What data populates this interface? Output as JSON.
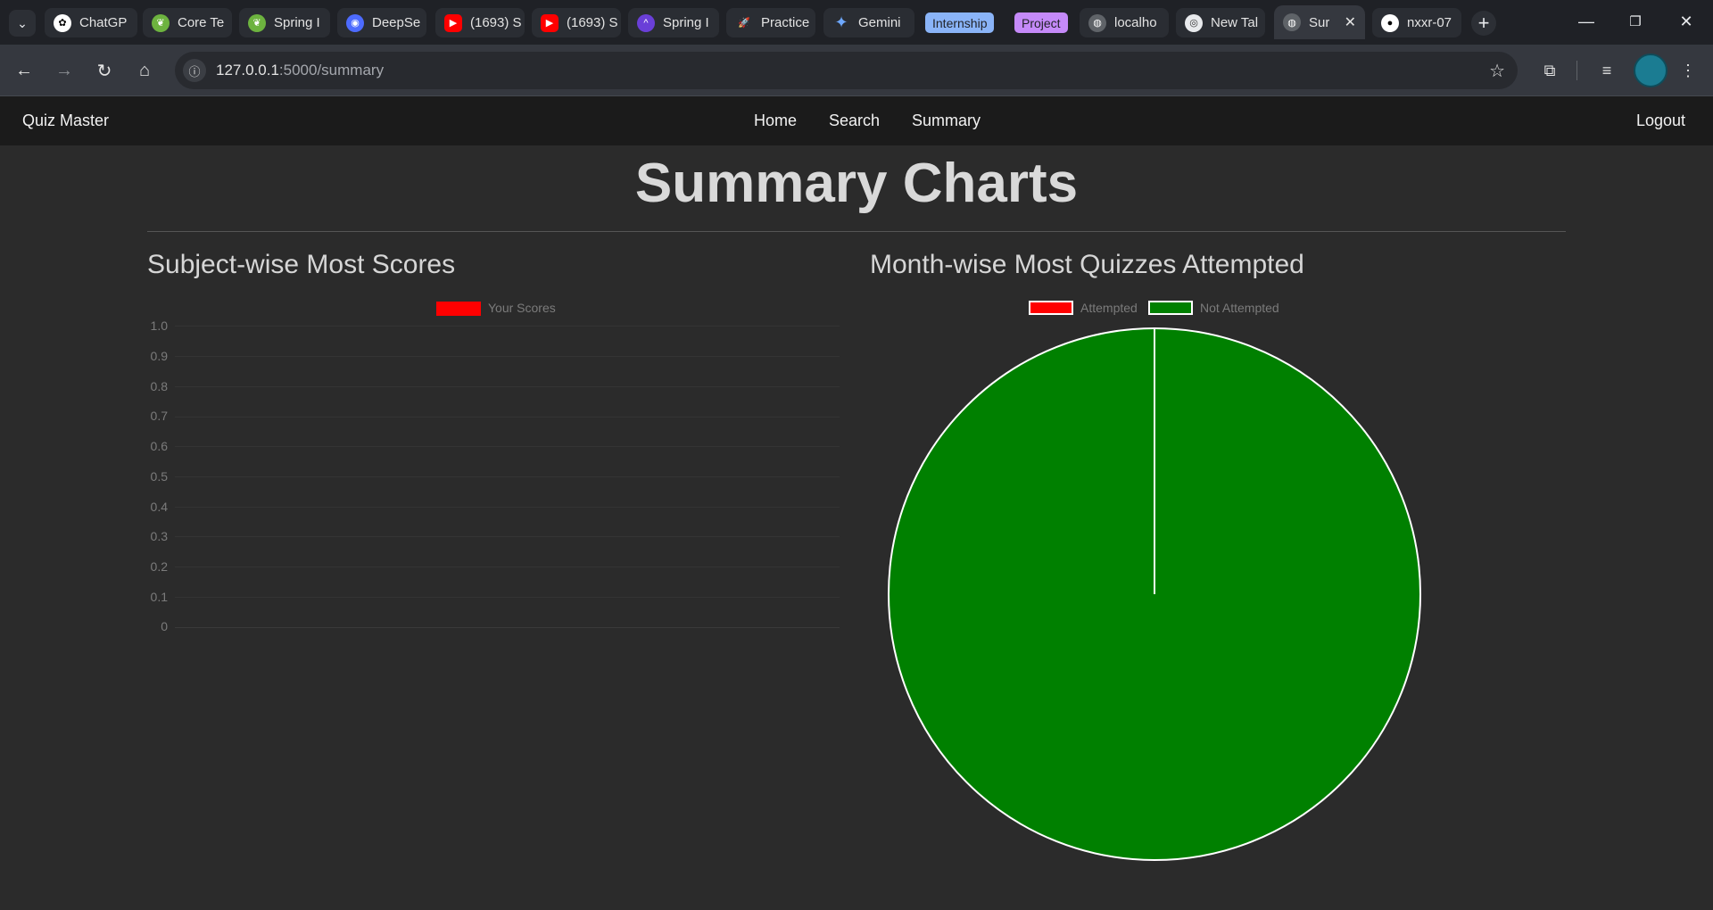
{
  "browser": {
    "tabs": [
      {
        "title": "ChatGP",
        "icon": "chatgpt-icon"
      },
      {
        "title": "Core Te",
        "icon": "spring-leaf-icon"
      },
      {
        "title": "Spring I",
        "icon": "spring-leaf-icon"
      },
      {
        "title": "DeepSe",
        "icon": "deepseek-whale-icon"
      },
      {
        "title": "(1693) S",
        "icon": "youtube-icon"
      },
      {
        "title": "(1693) S",
        "icon": "youtube-icon"
      },
      {
        "title": "Spring I",
        "icon": "spring-course-icon"
      },
      {
        "title": "Practice",
        "icon": "rocket-icon"
      },
      {
        "title": "Gemini",
        "icon": "gemini-sparkle-icon"
      },
      {
        "title": "localho",
        "icon": "globe-icon"
      },
      {
        "title": "New Tal",
        "icon": "chrome-icon"
      },
      {
        "title": "Sur",
        "icon": "globe-icon",
        "active": true
      },
      {
        "title": "nxxr-07",
        "icon": "github-icon"
      }
    ],
    "tab_groups": [
      {
        "label": "Internship",
        "color": "#8ab4f8"
      },
      {
        "label": "Project",
        "color": "#c58af9"
      }
    ],
    "url_host": "127.0.0.1",
    "url_path": ":5000/summary"
  },
  "app": {
    "brand": "Quiz Master",
    "nav": {
      "home": "Home",
      "search": "Search",
      "summary": "Summary",
      "logout": "Logout"
    },
    "page_title": "Summary Charts"
  },
  "chart_data": [
    {
      "type": "bar",
      "title": "Subject-wise Most Scores",
      "categories": [],
      "series": [
        {
          "name": "Your Scores",
          "values": [],
          "color": "#ff0000"
        }
      ],
      "yticks": [
        "1.0",
        "0.9",
        "0.8",
        "0.7",
        "0.6",
        "0.5",
        "0.4",
        "0.3",
        "0.2",
        "0.1",
        "0"
      ],
      "ylim": [
        0,
        1
      ],
      "legend": "top-center"
    },
    {
      "type": "pie",
      "title": "Month-wise Most Quizzes Attempted",
      "labels": [
        "Attempted",
        "Not Attempted"
      ],
      "values": [
        0,
        1
      ],
      "colors": [
        "#ff0000",
        "#008000"
      ],
      "legend": "top-center"
    }
  ]
}
